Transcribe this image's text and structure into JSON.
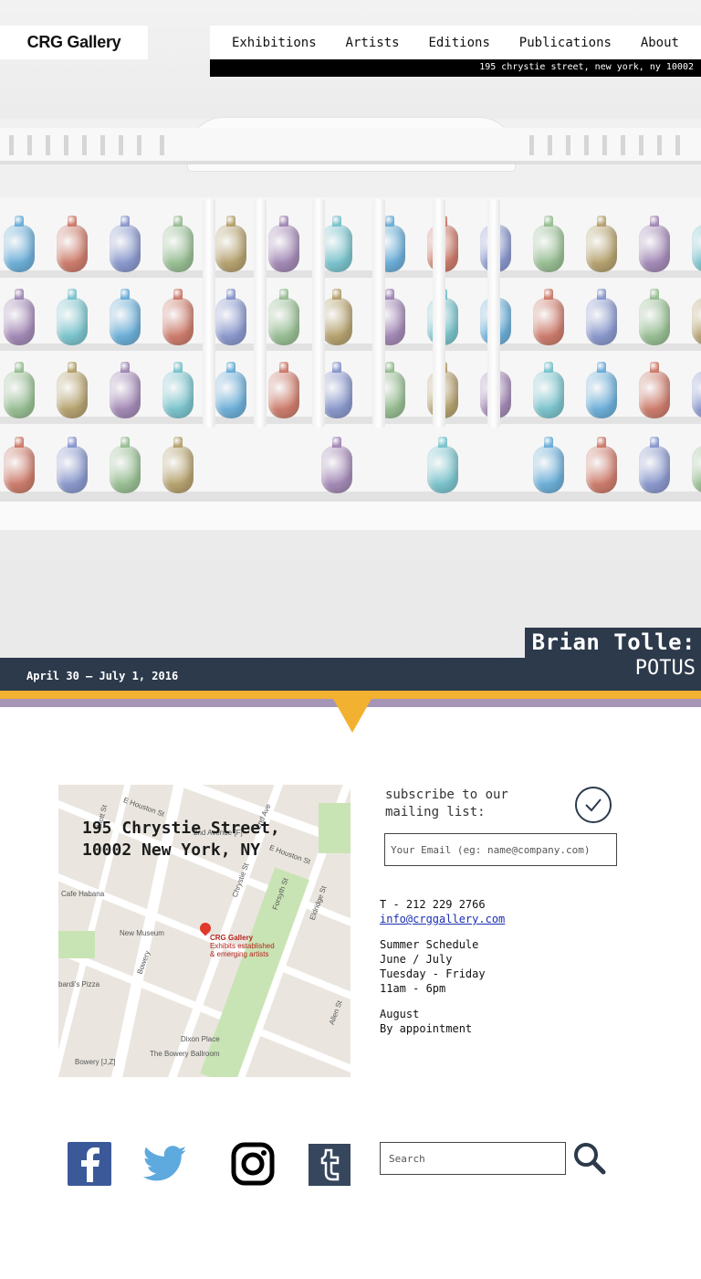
{
  "header": {
    "logo": "CRG Gallery",
    "nav": [
      "Exhibitions",
      "Artists",
      "Editions",
      "Publications",
      "About"
    ],
    "address": "195 chrystie street, new york, ny 10002"
  },
  "hero": {
    "artist": "Brian Tolle:",
    "show": "POTUS",
    "dates": "April 30 — July 1, 2016"
  },
  "map": {
    "address_line1": "195 Chrystie Street,",
    "address_line2": "10002 New York, NY",
    "pin_name": "CRG Gallery",
    "pin_desc1": "Exhibits established",
    "pin_desc2": "& emerging artists",
    "labels": {
      "houston": "E Houston St",
      "cafe": "Cafe Habana",
      "museum": "New Museum",
      "pizza": "bardi's Pizza",
      "dixon": "Dixon Place",
      "ballroom": "The Bowery Ballroom",
      "bowery_station": "Bowery [J,Z]",
      "second_ave": "2nd Ave",
      "chrystie": "Chrystie St",
      "forsyth": "Forsyth St",
      "eldridge": "Eldridge St",
      "allen": "Allen St",
      "bowery": "Bowery",
      "mott": "Mott St",
      "houston2": "E Houston St",
      "station2": "2nd Avenue [F]"
    }
  },
  "subscribe": {
    "label": "subscribe to our mailing list:",
    "placeholder": "Your Email (eg: name@company.com)"
  },
  "contact": {
    "phone": "T - 212 229 2766",
    "email": "info@crggallery.com",
    "schedule_title": "Summer Schedule",
    "months": "June / July",
    "days": "Tuesday - Friday",
    "hours": "11am - 6pm",
    "august": "August",
    "august_note": "By appointment"
  },
  "social": {
    "icons": [
      "facebook-icon",
      "twitter-icon",
      "instagram-icon",
      "tumblr-icon"
    ]
  },
  "search": {
    "placeholder": "Search"
  },
  "colors": {
    "navy": "#2c3a4b",
    "orange": "#f2b131",
    "purple": "#a596b8",
    "facebook": "#3b5998",
    "twitter": "#5ea9dd",
    "tumblr": "#36465d"
  }
}
